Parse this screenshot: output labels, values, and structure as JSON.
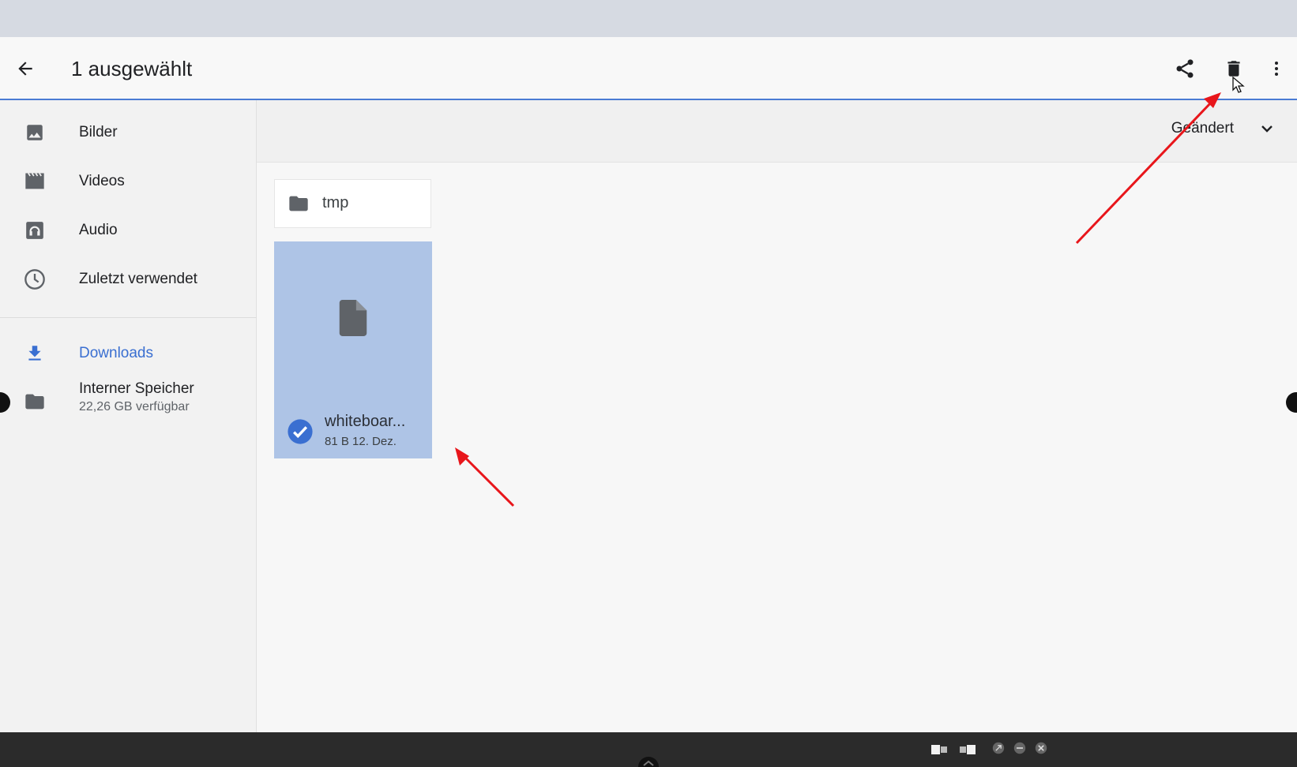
{
  "appbar": {
    "title": "1 ausgewählt",
    "icons": [
      "back-arrow-icon",
      "share-icon",
      "delete-icon",
      "more-vert-icon"
    ]
  },
  "sidebar": {
    "items": [
      {
        "label": "Bilder",
        "icon": "image-icon"
      },
      {
        "label": "Videos",
        "icon": "video-icon"
      },
      {
        "label": "Audio",
        "icon": "audio-icon"
      },
      {
        "label": "Zuletzt verwendet",
        "icon": "clock-icon"
      },
      {
        "label": "Downloads",
        "icon": "download-icon",
        "active": true
      },
      {
        "label": "Interner Speicher",
        "sublabel": "22,26 GB verfügbar",
        "icon": "folder-icon"
      }
    ]
  },
  "content": {
    "sort_label": "Geändert",
    "folder": {
      "name": "tmp"
    },
    "file": {
      "name": "whiteboar...",
      "meta": "81 B 12. Dez.",
      "selected": true
    }
  },
  "colors": {
    "accent": "#3a6fd1",
    "selection": "#aec4e6",
    "annotation": "#e8161b"
  }
}
